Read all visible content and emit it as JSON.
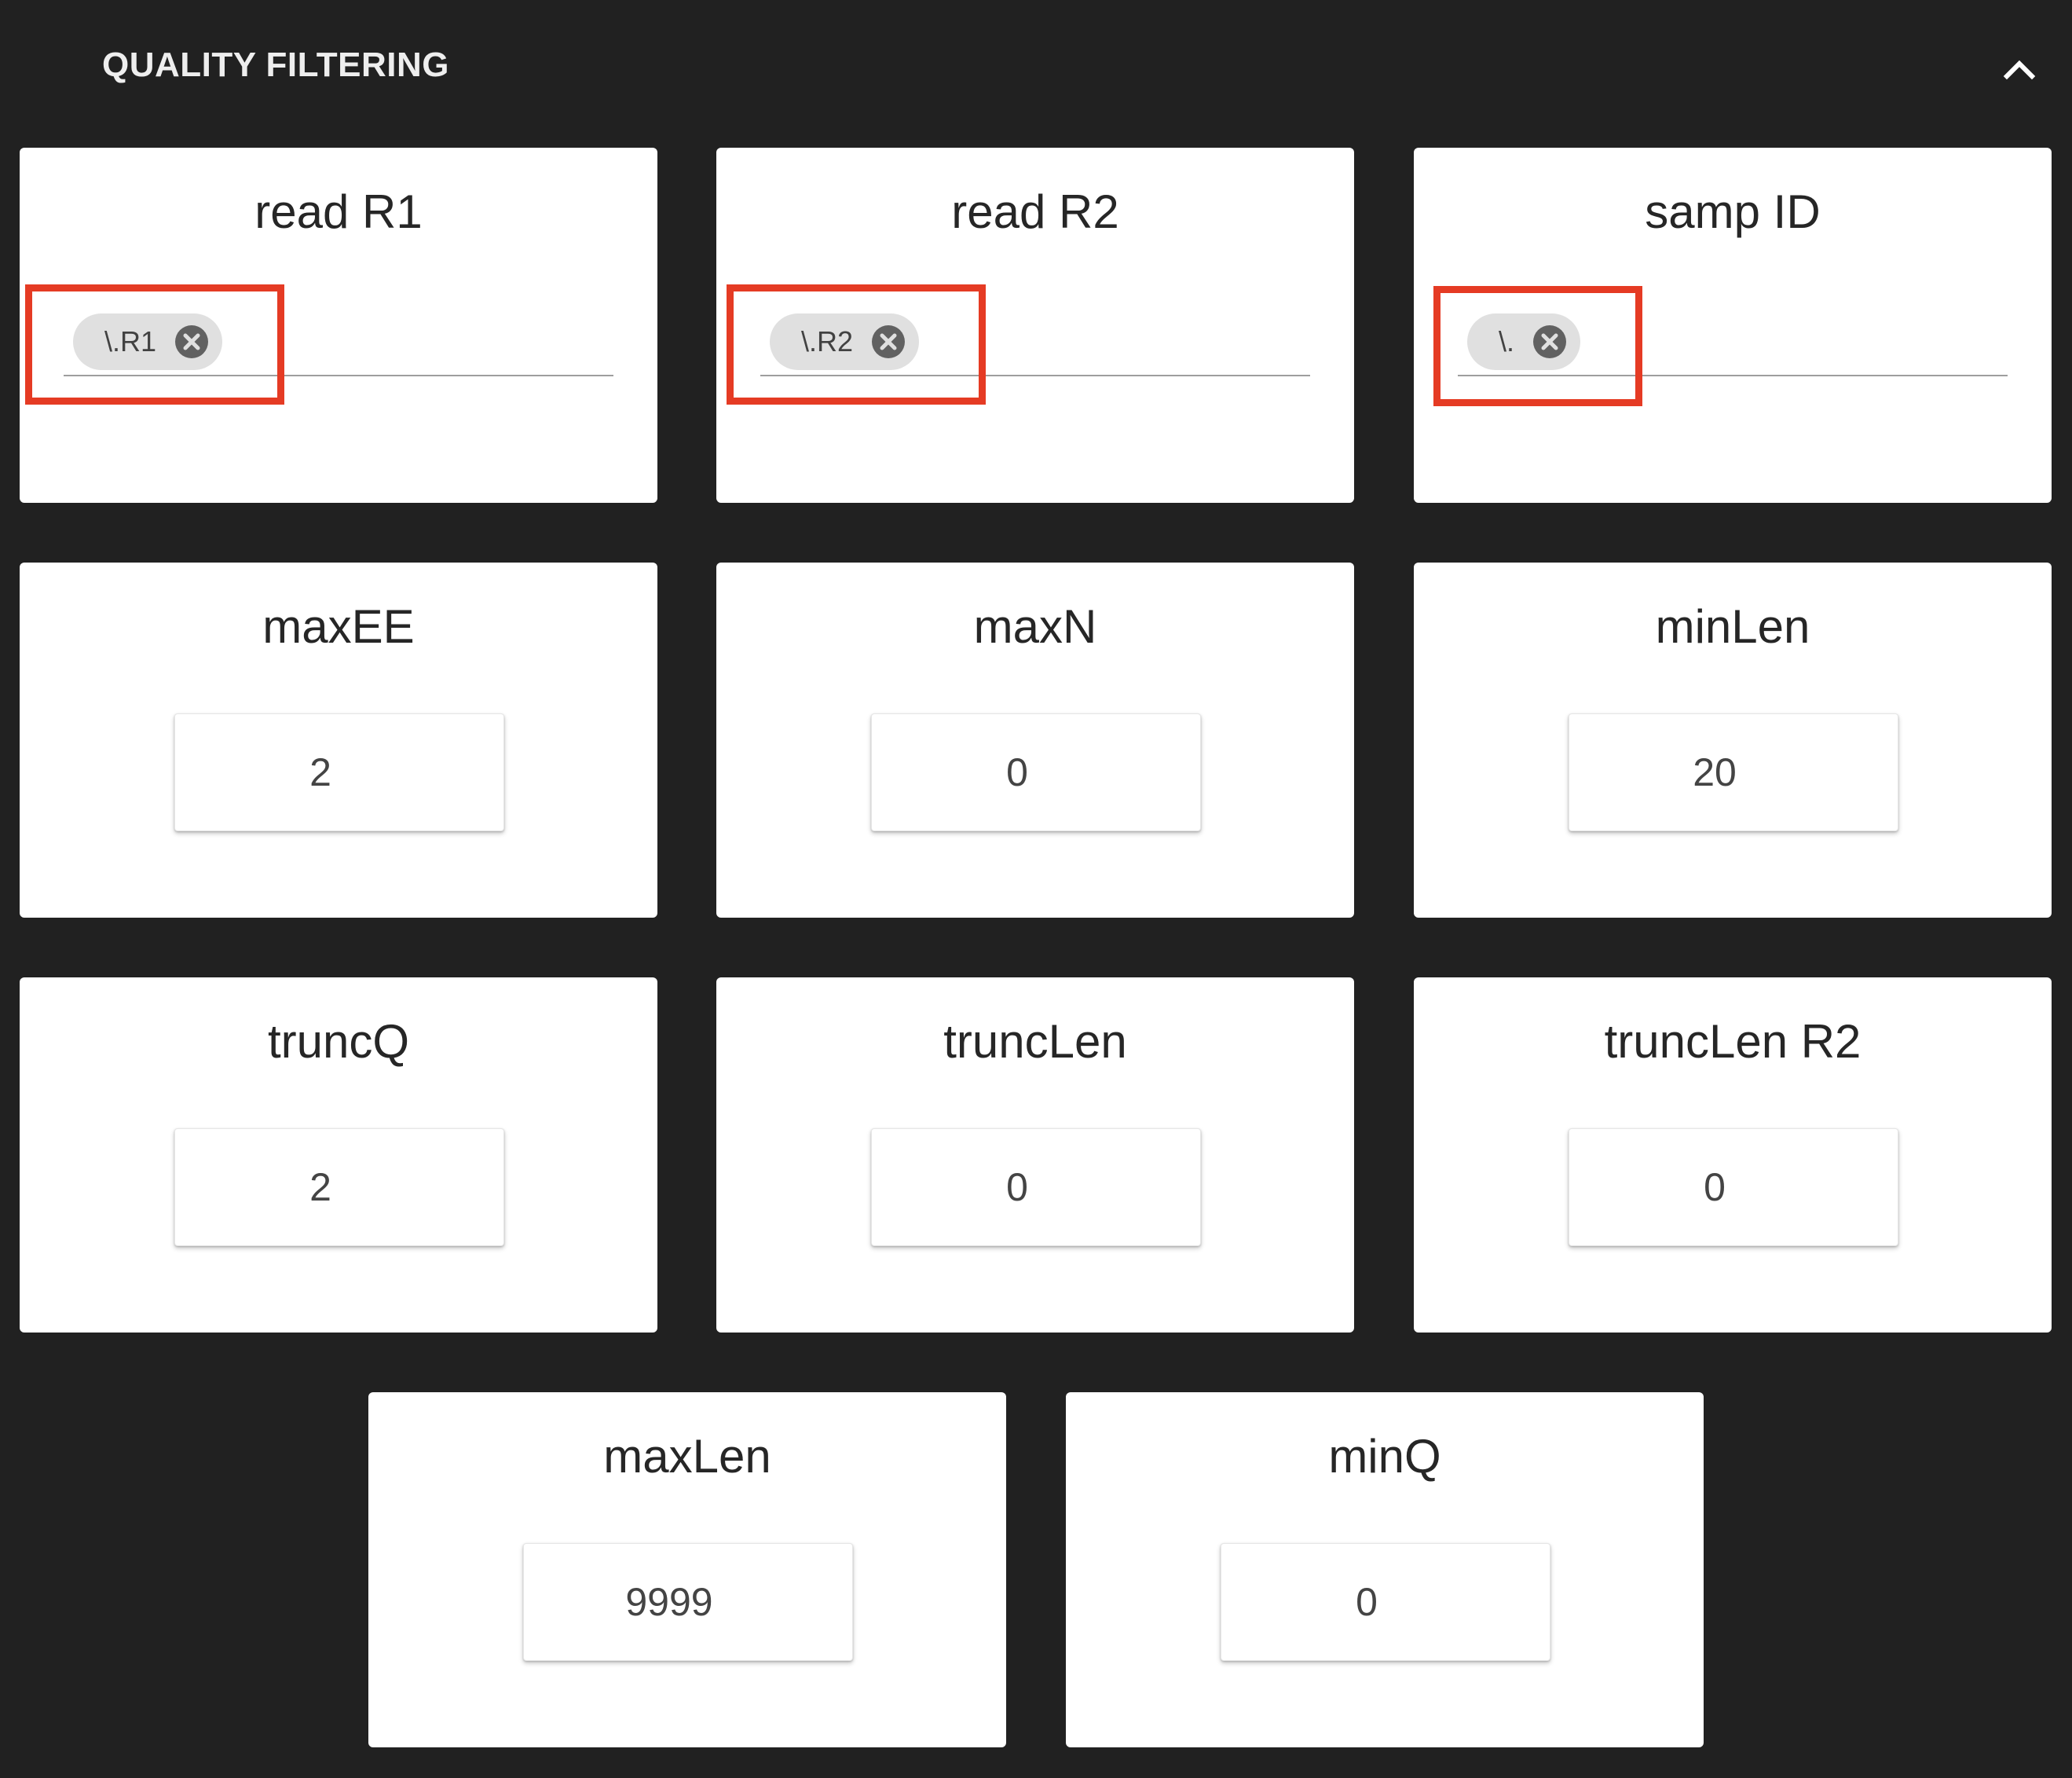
{
  "section": {
    "title": "QUALITY FILTERING",
    "collapse_icon": "chevron-up-icon"
  },
  "text_fields": [
    {
      "label": "read R1",
      "chip": "\\.R1"
    },
    {
      "label": "read R2",
      "chip": "\\.R2"
    },
    {
      "label": "samp ID",
      "chip": "\\."
    }
  ],
  "number_fields": [
    {
      "label": "maxEE",
      "value": "2"
    },
    {
      "label": "maxN",
      "value": "0"
    },
    {
      "label": "minLen",
      "value": "20"
    },
    {
      "label": "truncQ",
      "value": "2"
    },
    {
      "label": "truncLen",
      "value": "0"
    },
    {
      "label": "truncLen R2",
      "value": "0"
    },
    {
      "label": "maxLen",
      "value": "9999"
    },
    {
      "label": "minQ",
      "value": "0"
    }
  ],
  "colors": {
    "background": "#212121",
    "card": "#ffffff",
    "chip": "#e0e0e0",
    "highlight": "#e53b24"
  }
}
